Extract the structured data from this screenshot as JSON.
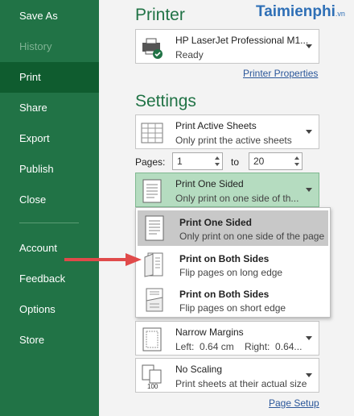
{
  "sidebar": {
    "items": [
      {
        "label": "Save As"
      },
      {
        "label": "History"
      },
      {
        "label": "Print"
      },
      {
        "label": "Share"
      },
      {
        "label": "Export"
      },
      {
        "label": "Publish"
      },
      {
        "label": "Close"
      },
      {
        "label": "Account"
      },
      {
        "label": "Feedback"
      },
      {
        "label": "Options"
      },
      {
        "label": "Store"
      }
    ]
  },
  "printer": {
    "title": "Printer",
    "name": "HP LaserJet Professional M1...",
    "status": "Ready",
    "properties_link": "Printer Properties"
  },
  "settings": {
    "title": "Settings",
    "scope": {
      "label": "Print Active Sheets",
      "desc": "Only print the active sheets"
    },
    "pages": {
      "label": "Pages:",
      "from": "1",
      "to_label": "to",
      "to": "20"
    },
    "sides": {
      "label": "Print One Sided",
      "desc": "Only print on one side of th..."
    },
    "margins": {
      "label": "Narrow Margins",
      "desc": "Left:  0.64 cm    Right:  0.64..."
    },
    "scaling": {
      "label": "No Scaling",
      "desc": "Print sheets at their actual size",
      "icon_text": "100"
    },
    "page_setup_link": "Page Setup"
  },
  "dropdown": {
    "items": [
      {
        "label": "Print One Sided",
        "desc": "Only print on one side of the page"
      },
      {
        "label": "Print on Both Sides",
        "desc": "Flip pages on long edge"
      },
      {
        "label": "Print on Both Sides",
        "desc": "Flip pages on short edge"
      }
    ]
  },
  "watermark": {
    "text": "Taimienphi",
    "suffix": ".vn"
  },
  "colors": {
    "sidebar": "#217346",
    "active": "#0f5c2f",
    "accent": "#217346",
    "arrow": "#e04a4a"
  }
}
